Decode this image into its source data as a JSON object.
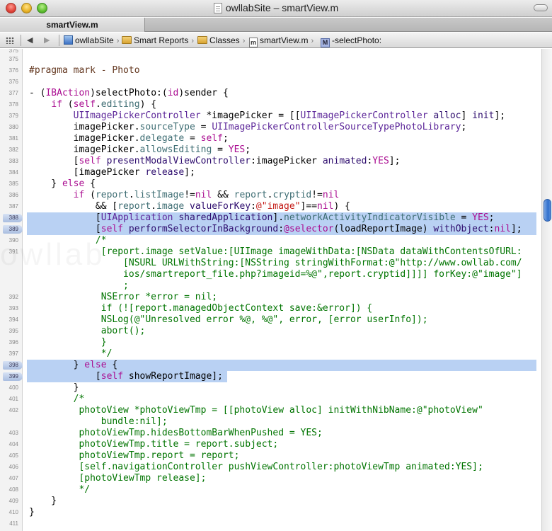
{
  "window": {
    "title": "owllabSite – smartView.m"
  },
  "tabs": [
    {
      "label": "smartView.m"
    }
  ],
  "jumpbar": {
    "back": "◀",
    "forward": "▶",
    "crumbs": [
      "owllabSite",
      "Smart Reports",
      "Classes",
      "smartView.m",
      "-selectPhoto:"
    ]
  },
  "editor": {
    "watermark": "owllab",
    "highlighted_lines": [
      "388",
      "389",
      "398",
      "399"
    ]
  }
}
